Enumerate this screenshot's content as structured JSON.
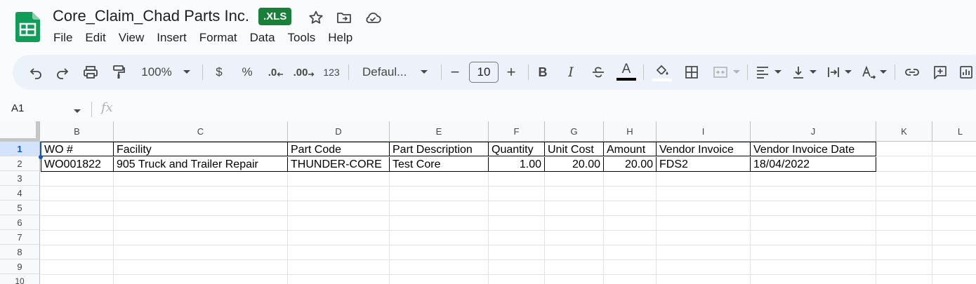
{
  "title_bar": {
    "document_title": "Core_Claim_Chad Parts Inc.",
    "file_badge": ".XLS",
    "star_icon": "star-icon",
    "move_icon": "folder-move-icon",
    "cloud_icon": "cloud-status-icon"
  },
  "menu": {
    "items": [
      "File",
      "Edit",
      "View",
      "Insert",
      "Format",
      "Data",
      "Tools",
      "Help"
    ]
  },
  "toolbar": {
    "zoom": "100%",
    "currency": "$",
    "percent": "%",
    "decrease_decimal": ".0",
    "increase_decimal": ".00",
    "number_format": "123",
    "font_name": "Defaul...",
    "font_size": "10",
    "minus": "−",
    "plus": "+",
    "bold": "B",
    "italic": "I",
    "text_color": "A",
    "text_color_value": "#000000"
  },
  "formula_bar": {
    "name_box": "A1",
    "fx": "fx",
    "formula": ""
  },
  "grid": {
    "columns": [
      "B",
      "C",
      "D",
      "E",
      "F",
      "G",
      "H",
      "I",
      "J",
      "K",
      "L"
    ],
    "rows": [
      "1",
      "2",
      "3",
      "4",
      "5",
      "6",
      "7",
      "8",
      "9",
      "10"
    ],
    "header_row": [
      "WO #",
      "Facility",
      "Part Code",
      "Part Description",
      "Quantity",
      "Unit Cost",
      "Amount",
      "Vendor Invoice",
      "Vendor Invoice Date"
    ],
    "data_row": [
      "WO001822",
      "905 Truck and Trailer Repair",
      "THUNDER-CORE",
      "Test Core",
      "1.00",
      "20.00",
      "20.00",
      "FDS2",
      "18/04/2022"
    ]
  },
  "colors": {
    "accent": "#0b57d0",
    "badge": "#188038",
    "toolbar_bg": "#edf2fa"
  }
}
